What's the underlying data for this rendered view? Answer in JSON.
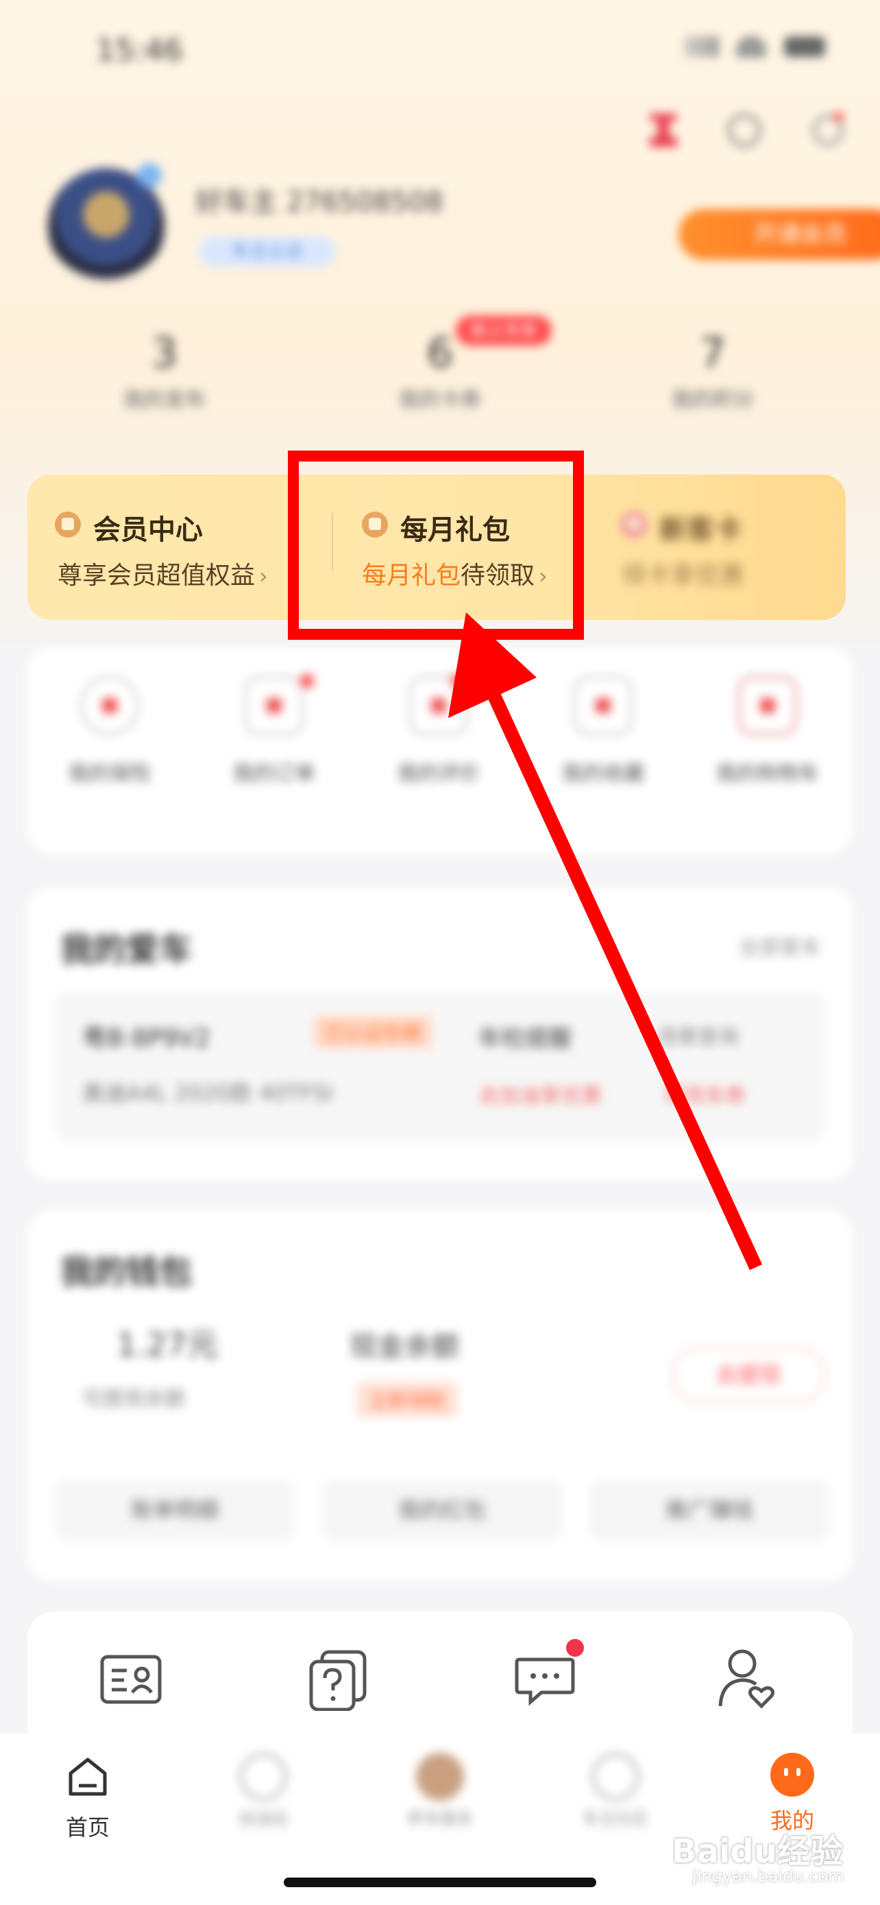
{
  "status_bar": {
    "time": "15:46"
  },
  "profile": {
    "username": "好车主 276508508",
    "level_badge": "车主认证",
    "vip_button": "开通会员"
  },
  "stats": [
    {
      "value": "3",
      "label": "我的发布"
    },
    {
      "value": "6",
      "label": "我的卡券",
      "badge": "新人专享"
    },
    {
      "value": "7",
      "label": "我的积分"
    }
  ],
  "member_strip": {
    "item1": {
      "title": "会员中心",
      "subtitle": "尊享会员超值权益"
    },
    "item2": {
      "title": "每月礼包",
      "subtitle_highlight": "每月礼包",
      "subtitle_rest": "待领取"
    },
    "item3": {
      "title": "新客卡",
      "subtitle": "领卡享优惠"
    }
  },
  "quick_grid": [
    {
      "label": "我的保险"
    },
    {
      "label": "我的订单"
    },
    {
      "label": "我的评价"
    },
    {
      "label": "我的收藏"
    },
    {
      "label": "我的购物车"
    }
  ],
  "garage": {
    "title": "我的爱车",
    "more": "全部爱车",
    "plate": "粤B·8P9V2",
    "plate_tag": "已认证车辆",
    "model": "奥迪A4L 2020款 40TFSI",
    "line2_a": "年检提醒",
    "line2_b": "违章查询",
    "link_a": "去加油享优惠",
    "link_b": "领洗车券"
  },
  "wallet": {
    "title": "我的钱包",
    "amount": "1.27元",
    "amount_label": "可提现余额",
    "fund_label": "现金余额",
    "fund_tag": "立即领取",
    "action_button": "去提现",
    "buttons": [
      "账单明细",
      "我的红包",
      "推广赚钱"
    ]
  },
  "tabbar": {
    "home": "首页",
    "tab2": "加油站",
    "tab3": "养车服务",
    "tab4": "车主社区",
    "mine": "我的"
  },
  "watermark": {
    "text": "Baidu经验",
    "sub": "jingyan.baidu.com"
  }
}
